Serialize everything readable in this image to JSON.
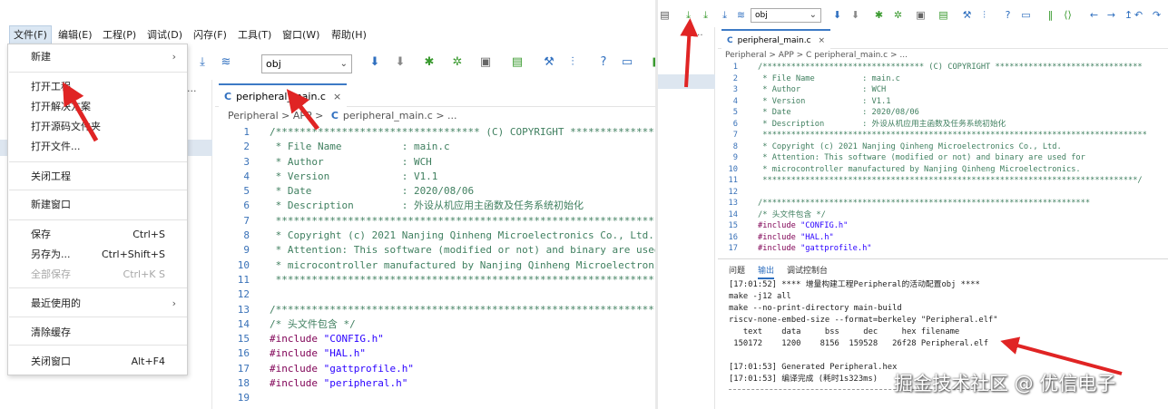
{
  "menubar": [
    "文件(F)",
    "编辑(E)",
    "工程(P)",
    "调试(D)",
    "闪存(F)",
    "工具(T)",
    "窗口(W)",
    "帮助(H)"
  ],
  "file_menu": [
    {
      "label": "新建",
      "shortcut": "",
      "submenu": true,
      "disabled": false
    },
    {
      "label": "打开工程",
      "shortcut": "",
      "submenu": false,
      "disabled": false
    },
    {
      "label": "打开解决方案",
      "shortcut": "",
      "submenu": false,
      "disabled": false
    },
    {
      "label": "打开源码文件夹",
      "shortcut": "",
      "submenu": false,
      "disabled": false
    },
    {
      "label": "打开文件...",
      "shortcut": "",
      "submenu": false,
      "disabled": false
    },
    {
      "label": "关闭工程",
      "shortcut": "",
      "submenu": false,
      "disabled": false
    },
    {
      "label": "新建窗口",
      "shortcut": "",
      "submenu": false,
      "disabled": false
    },
    {
      "label": "保存",
      "shortcut": "Ctrl+S",
      "submenu": false,
      "disabled": false
    },
    {
      "label": "另存为...",
      "shortcut": "Ctrl+Shift+S",
      "submenu": false,
      "disabled": false
    },
    {
      "label": "全部保存",
      "shortcut": "Ctrl+K S",
      "submenu": false,
      "disabled": true
    },
    {
      "label": "最近使用的",
      "shortcut": "",
      "submenu": true,
      "disabled": false
    },
    {
      "label": "清除缓存",
      "shortcut": "",
      "submenu": false,
      "disabled": false
    },
    {
      "label": "关闭窗口",
      "shortcut": "Alt+F4",
      "submenu": false,
      "disabled": false
    }
  ],
  "toolbar": {
    "config_value": "obj"
  },
  "editor": {
    "tab_badge": "C",
    "tab_label": "peripheral_main.c",
    "close": "×",
    "breadcrumb_left": "Peripheral  >  APP  >",
    "breadcrumb_file": "peripheral_main.c",
    "breadcrumb_tail": "> ...",
    "breadcrumb_right": "Peripheral > APP > C peripheral_main.c > ..."
  },
  "code_lines": [
    {
      "n": "1",
      "t": "/********************************** (C) COPYRIGHT *******************************",
      "k": "cm"
    },
    {
      "n": "2",
      "t": " * File Name          : main.c",
      "k": "cm"
    },
    {
      "n": "3",
      "t": " * Author             : WCH",
      "k": "cm"
    },
    {
      "n": "4",
      "t": " * Version            : V1.1",
      "k": "cm"
    },
    {
      "n": "5",
      "t": " * Date               : 2020/08/06",
      "k": "cm"
    },
    {
      "n": "6",
      "t": " * Description        : 外设从机应用主函数及任务系统初始化",
      "k": "cm"
    },
    {
      "n": "7",
      "t": " *********************************************************************************",
      "k": "cm"
    },
    {
      "n": "8",
      "t": " * Copyright (c) 2021 Nanjing Qinheng Microelectronics Co., Ltd.",
      "k": "cm"
    },
    {
      "n": "9",
      "t": " * Attention: This software (modified or not) and binary are used for",
      "k": "cm"
    },
    {
      "n": "10",
      "t": " * microcontroller manufactured by Nanjing Qinheng Microelectronics.",
      "k": "cm"
    },
    {
      "n": "11",
      "t": " *******************************************************************************/",
      "k": "cm"
    },
    {
      "n": "12",
      "t": "",
      "k": "cm"
    },
    {
      "n": "13",
      "t": "/*********************************************************************",
      "k": "cm"
    },
    {
      "n": "14",
      "t": "/* 头文件包含 */",
      "k": "cm"
    },
    {
      "n": "15",
      "t": "#include \"CONFIG.h\"",
      "k": "pp"
    },
    {
      "n": "16",
      "t": "#include \"HAL.h\"",
      "k": "pp"
    },
    {
      "n": "17",
      "t": "#include \"gattprofile.h\"",
      "k": "pp"
    },
    {
      "n": "18",
      "t": "#include \"peripheral.h\"",
      "k": "pp"
    },
    {
      "n": "19",
      "t": "",
      "k": "cm"
    }
  ],
  "console": {
    "tabs": [
      "问题",
      "输出",
      "调试控制台"
    ],
    "lines": [
      "[17:01:52] **** 增量构建工程Peripheral的活动配置obj ****",
      "make -j12 all",
      "make --no-print-directory main-build",
      "riscv-none-embed-size --format=berkeley \"Peripheral.elf\"",
      "   text    data     bss     dec     hex filename",
      " 150172    1200    8156  159528   26f28 Peripheral.elf",
      "",
      "[17:01:53] Generated Peripheral.hex",
      "[17:01:53] 编译完成 (耗时1s323ms)"
    ]
  },
  "watermark": "掘金技术社区 @ 优信电子",
  "colors": {
    "arrow": "#e02424",
    "accent": "#2f6fbf",
    "comment": "#3f7f5f",
    "preproc": "#7f0055",
    "string": "#2a00ff"
  }
}
